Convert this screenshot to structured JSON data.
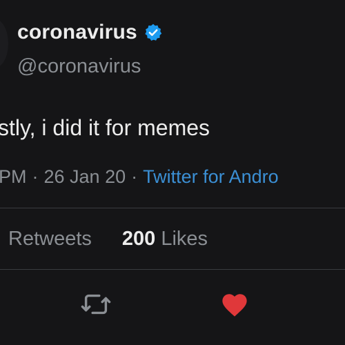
{
  "tweet": {
    "display_name": "coronavirus",
    "handle": "@coronavirus",
    "text": "stly, i did it for memes",
    "time": "PM",
    "date": "26 Jan 20",
    "separator": "·",
    "source": "Twitter for Andro"
  },
  "stats": {
    "retweets_label": "Retweets",
    "likes_count": "200",
    "likes_label": "Likes"
  },
  "actions": {
    "retweet_icon": "retweet-icon",
    "like_icon": "heart-icon"
  },
  "colors": {
    "background": "#151517",
    "verified": "#1d9bf0",
    "link": "#3b8fd4",
    "like_active": "#e0383a",
    "muted_text": "#8b8f94"
  }
}
